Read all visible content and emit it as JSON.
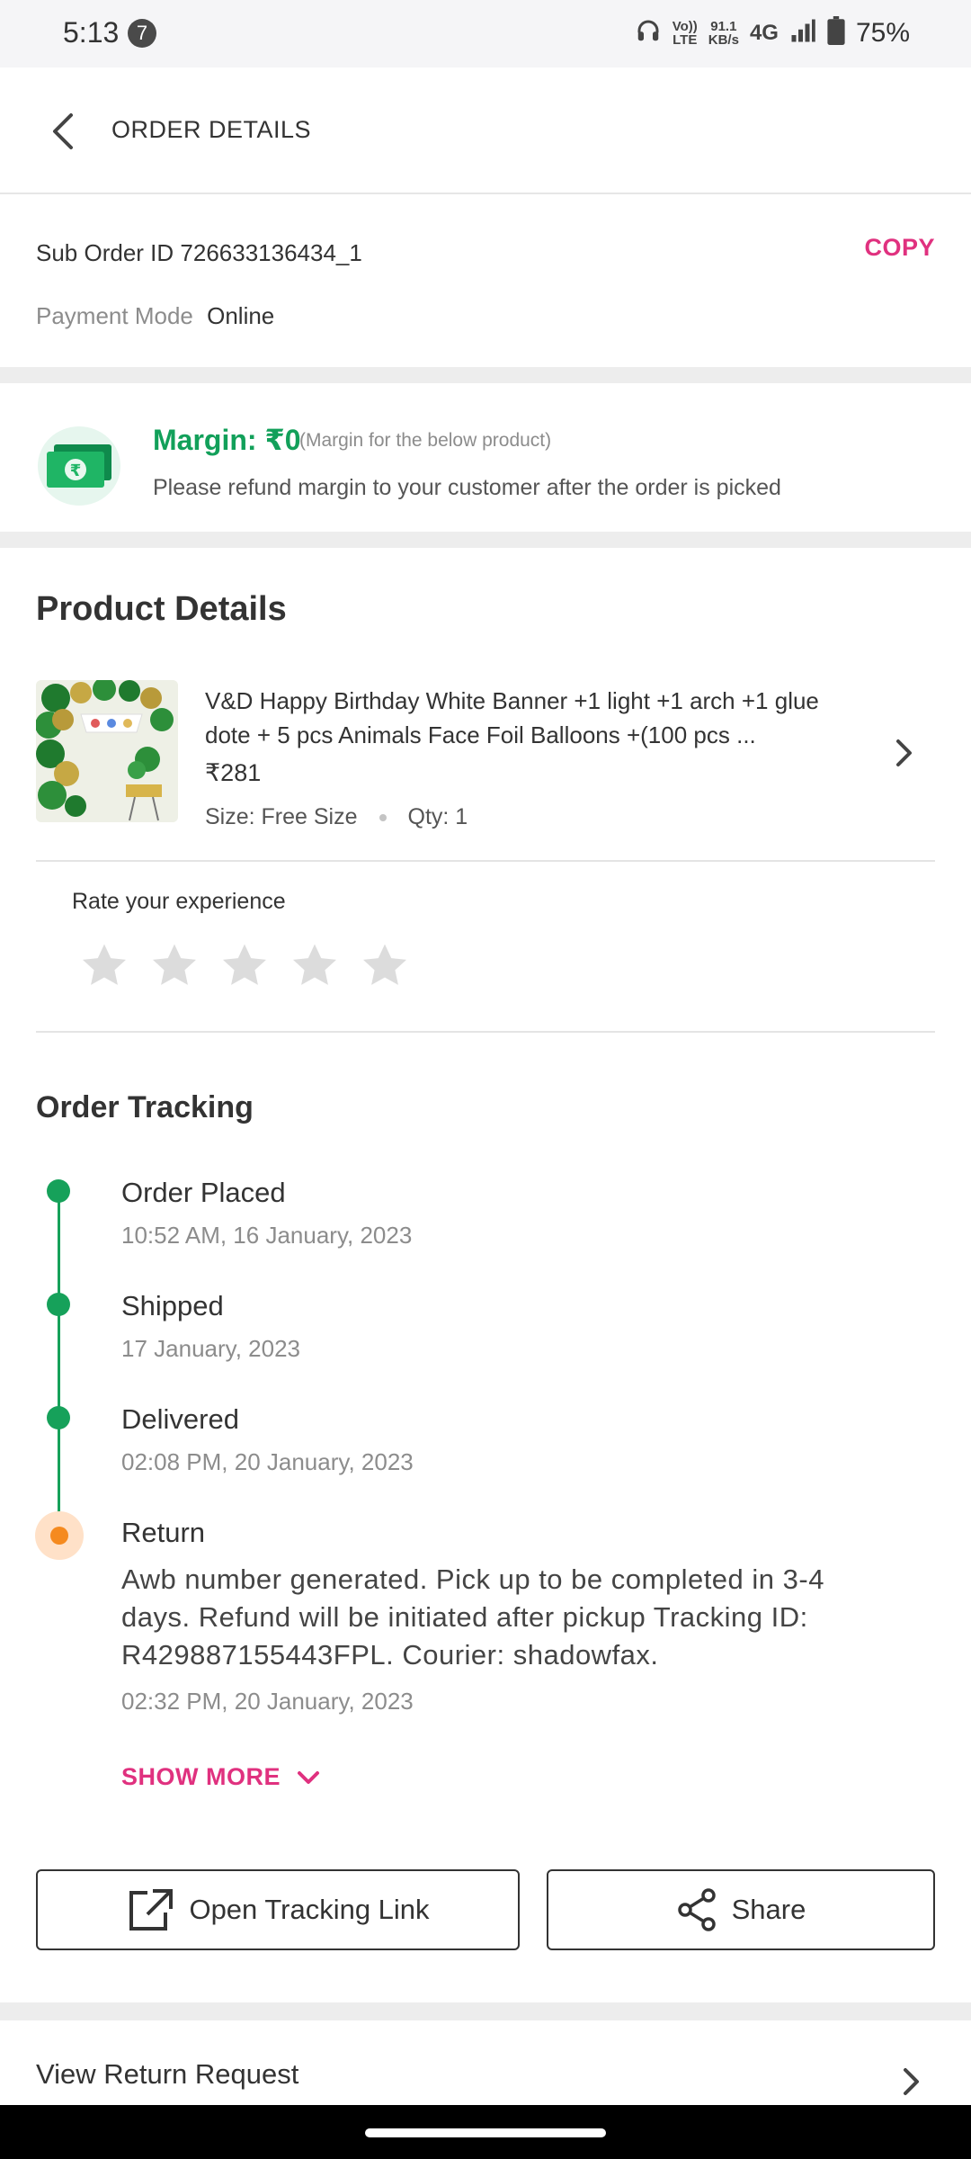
{
  "status_bar": {
    "time": "5:13",
    "notification_count": "7",
    "volte_top": "Vo))",
    "volte_bottom": "LTE",
    "speed_top": "91.1",
    "speed_bottom": "KB/s",
    "network": "4G",
    "battery": "75%"
  },
  "header": {
    "title": "ORDER DETAILS"
  },
  "suborder": {
    "id_text": "Sub Order ID 726633136434_1",
    "copy_label": "COPY",
    "payment_label": "Payment Mode",
    "payment_value": "Online"
  },
  "margin": {
    "title": "Margin: ₹0",
    "subtitle": "(Margin for the below product)",
    "message": "Please refund margin to your customer after the order is picked"
  },
  "product": {
    "heading": "Product Details",
    "name": "V&D  Happy Birthday  White Banner +1 light +1 arch +1 glue dote + 5 pcs Animals Face Foil Balloons +(100 pcs  ...",
    "price": "₹281",
    "size": "Size: Free Size",
    "qty": "Qty: 1"
  },
  "rating": {
    "label": "Rate your experience",
    "stars": 5,
    "value": 0
  },
  "tracking": {
    "heading": "Order Tracking",
    "steps": [
      {
        "title": "Order Placed",
        "date": "10:52 AM, 16 January, 2023",
        "status": "done"
      },
      {
        "title": "Shipped",
        "date": "17 January, 2023",
        "status": "done"
      },
      {
        "title": "Delivered",
        "date": "02:08 PM, 20 January, 2023",
        "status": "done"
      },
      {
        "title": "Return",
        "description": "Awb number generated. Pick up to be completed in 3-4 days. Refund will be initiated after pickup Tracking ID: R429887155443FPL. Courier: shadowfax.",
        "date": "02:32 PM, 20 January, 2023",
        "status": "current"
      }
    ],
    "show_more": "SHOW MORE"
  },
  "actions": {
    "open_tracking": "Open Tracking Link",
    "share": "Share"
  },
  "return_request": {
    "label": "View Return Request"
  },
  "colors": {
    "accent_pink": "#e0317f",
    "success_green": "#16a15a",
    "return_orange": "#f58a1f"
  }
}
